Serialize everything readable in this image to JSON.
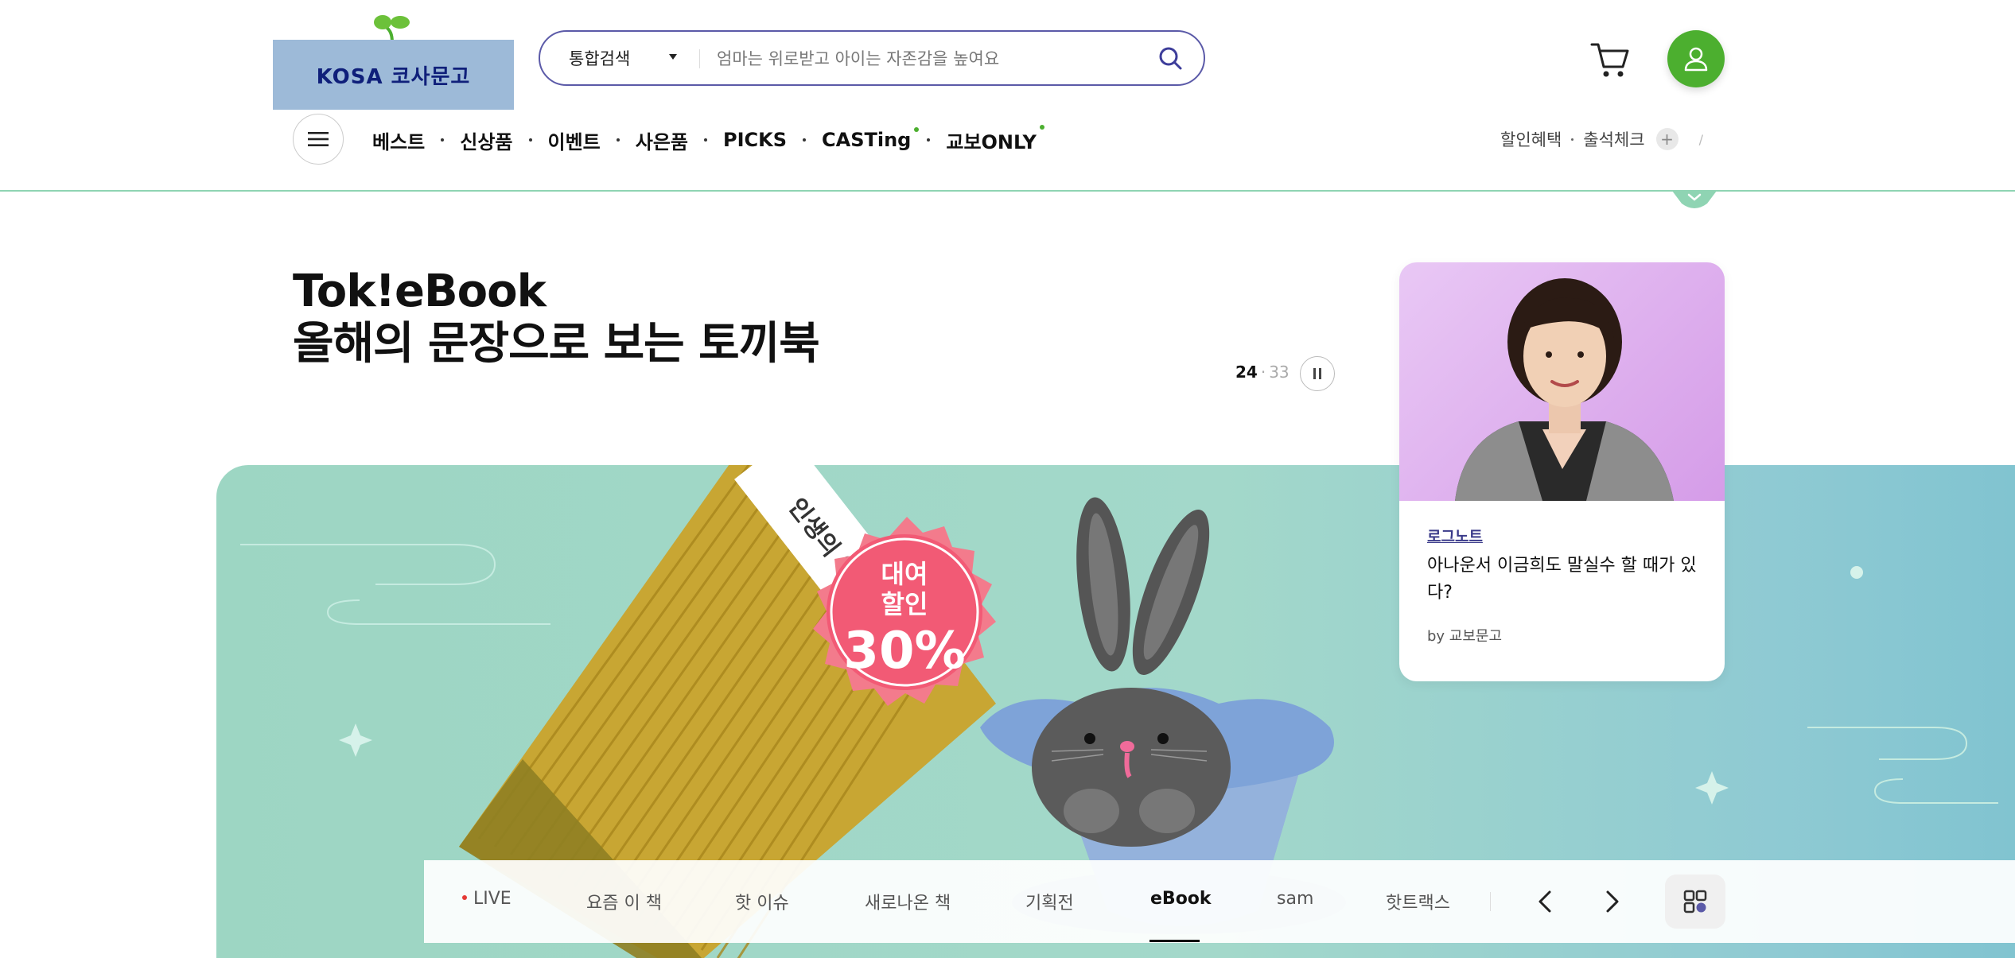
{
  "header": {
    "logo_text": "KOSA 코사문고",
    "search": {
      "type_label": "통합검색",
      "placeholder": "엄마는 위로받고 아이는 자존감을 높여요"
    }
  },
  "nav": {
    "items": [
      "베스트",
      "신상품",
      "이벤트",
      "사은품",
      "PICKS",
      "CASTing",
      "교보ONLY"
    ],
    "util": [
      "할인혜택",
      "출석체크"
    ],
    "plus_label": "+",
    "slash_label": "/"
  },
  "hero": {
    "title_line1": "Tok!eBook",
    "title_line2": "올해의 문장으로 보는 토끼북",
    "counter_current": "24",
    "counter_sep": "·",
    "counter_total": "33",
    "book_title": "인생의 역사",
    "badge_line1": "대여",
    "badge_line2": "할인",
    "badge_percent": "30%"
  },
  "card": {
    "tag": "로그노트",
    "title": "아나운서 이금희도 말실수 할 때가 있다?",
    "by": "by 교보문고"
  },
  "tabs": {
    "items": [
      "LIVE",
      "요즘 이 책",
      "핫 이슈",
      "새로나온 책",
      "기획전",
      "eBook",
      "sam",
      "핫트랙스"
    ],
    "active": "eBook"
  },
  "colors": {
    "accent_green": "#4caf2f",
    "search_border": "#5b5aa8",
    "banner_teal": "#9dd6c3",
    "live_red": "#e53935"
  }
}
